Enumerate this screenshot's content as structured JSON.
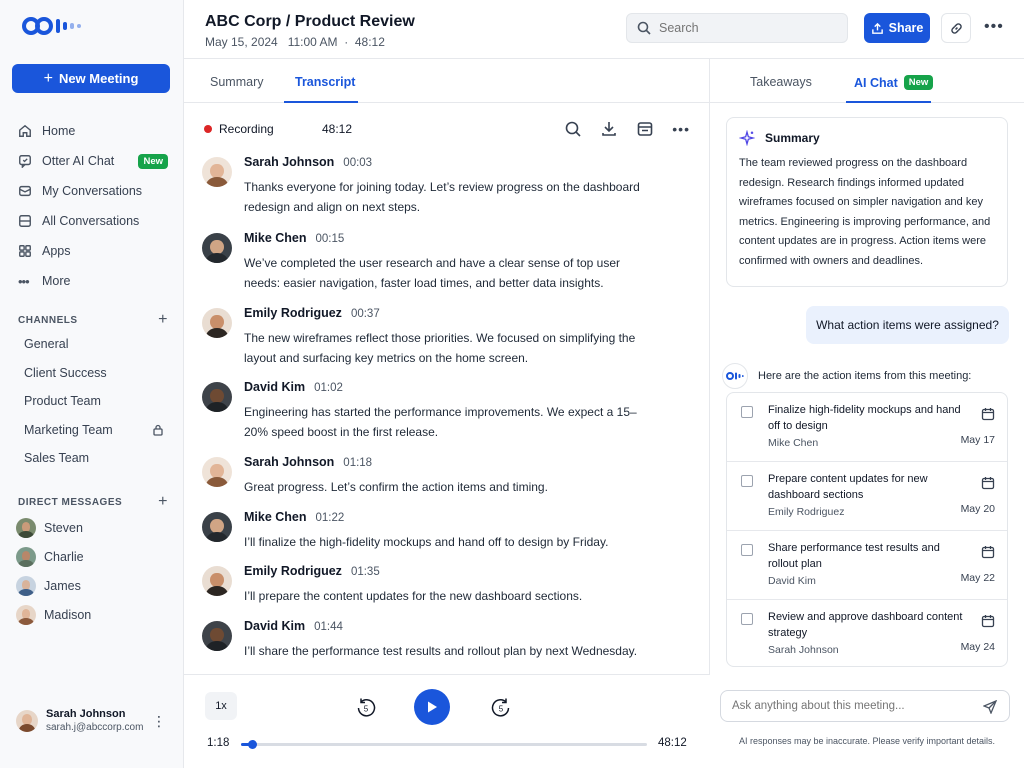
{
  "sidebar": {
    "new_meeting": "New Meeting",
    "nav": [
      {
        "label": "Home",
        "icon": "home-icon"
      },
      {
        "label": "Otter AI Chat",
        "icon": "chat-icon",
        "badge": "New"
      },
      {
        "label": "My Conversations",
        "icon": "conversations-icon"
      },
      {
        "label": "All Conversations",
        "icon": "all-conversations-icon"
      },
      {
        "label": "Apps",
        "icon": "apps-icon"
      },
      {
        "label": "More",
        "icon": "more-icon"
      }
    ],
    "channels_header": "CHANNELS",
    "channels": [
      "General",
      "Client Success",
      "Product Team",
      "Marketing Team",
      "Sales Team"
    ],
    "dm_header": "DIRECT MESSAGES",
    "dms": [
      "Steven",
      "Charlie",
      "James",
      "Madison"
    ],
    "user": {
      "name": "Sarah Johnson",
      "email": "sarah.j@abccorp.com"
    }
  },
  "header": {
    "title": "ABC Corp / Product Review",
    "meta": "May 15, 2024   11:00 AM  ·  48:12",
    "search_placeholder": "Search",
    "share_label": "Share"
  },
  "center": {
    "tabs": [
      "Summary",
      "Transcript"
    ],
    "active_tab": "Transcript",
    "recording_label": "Recording",
    "recording_time": "48:12",
    "messages": [
      {
        "name": "Sarah Johnson",
        "time": "00:03",
        "text": "Thanks everyone for joining today. Let’s review progress on the dashboard redesign and align on next steps."
      },
      {
        "name": "Mike Chen",
        "time": "00:15",
        "text": "We’ve completed the user research and have a clear sense of top user needs: easier navigation, faster load times, and better data insights."
      },
      {
        "name": "Emily Rodriguez",
        "time": "00:37",
        "text": "The new wireframes reflect those priorities. We focused on simplifying the layout and surfacing key metrics on the home screen."
      },
      {
        "name": "David Kim",
        "time": "01:02",
        "text": "Engineering has started the performance improvements. We expect a 15–20% speed boost in the first release."
      },
      {
        "name": "Sarah Johnson",
        "time": "01:18",
        "text": "Great progress. Let’s confirm the action items and timing."
      },
      {
        "name": "Mike Chen",
        "time": "01:22",
        "text": "I’ll finalize the high-fidelity mockups and hand off to design by Friday."
      },
      {
        "name": "Emily Rodriguez",
        "time": "01:35",
        "text": "I’ll prepare the content updates for the new dashboard sections."
      },
      {
        "name": "David Kim",
        "time": "01:44",
        "text": "I’ll share the performance test results and rollout plan by next Wednesday."
      }
    ],
    "player": {
      "speed": "1x",
      "current": "1:18",
      "total": "48:12",
      "progress": 0.027,
      "skip_seconds": "5"
    }
  },
  "right": {
    "tabs": [
      "Takeaways",
      "AI Chat"
    ],
    "active_tab": "AI Chat",
    "tab_badge": "New",
    "summary_title": "Summary",
    "summary_text": "The team reviewed progress on the dashboard redesign. Research findings informed updated wireframes focused on simpler navigation and key metrics. Engineering is improving performance, and content updates are in progress. Action items were confirmed with owners and deadlines.",
    "question": "What action items were assigned?",
    "answer_intro": "Here are the action items from this meeting:",
    "action_items": [
      {
        "text": "Finalize high-fidelity mockups and hand off to design",
        "owner": "Mike Chen",
        "due": "May 17"
      },
      {
        "text": "Prepare content updates for new dashboard sections",
        "owner": "Emily Rodriguez",
        "due": "May 20"
      },
      {
        "text": "Share performance test results and rollout plan",
        "owner": "David Kim",
        "due": "May 22"
      },
      {
        "text": "Review and approve dashboard content strategy",
        "owner": "Sarah Johnson",
        "due": "May 24"
      }
    ],
    "ask_placeholder": "Ask anything about this meeting...",
    "disclaimer": "AI responses may be inaccurate. Please verify important details."
  },
  "colors": {
    "accent": "#1a56db",
    "new_badge": "#16a34a",
    "recording": "#dc2626"
  }
}
